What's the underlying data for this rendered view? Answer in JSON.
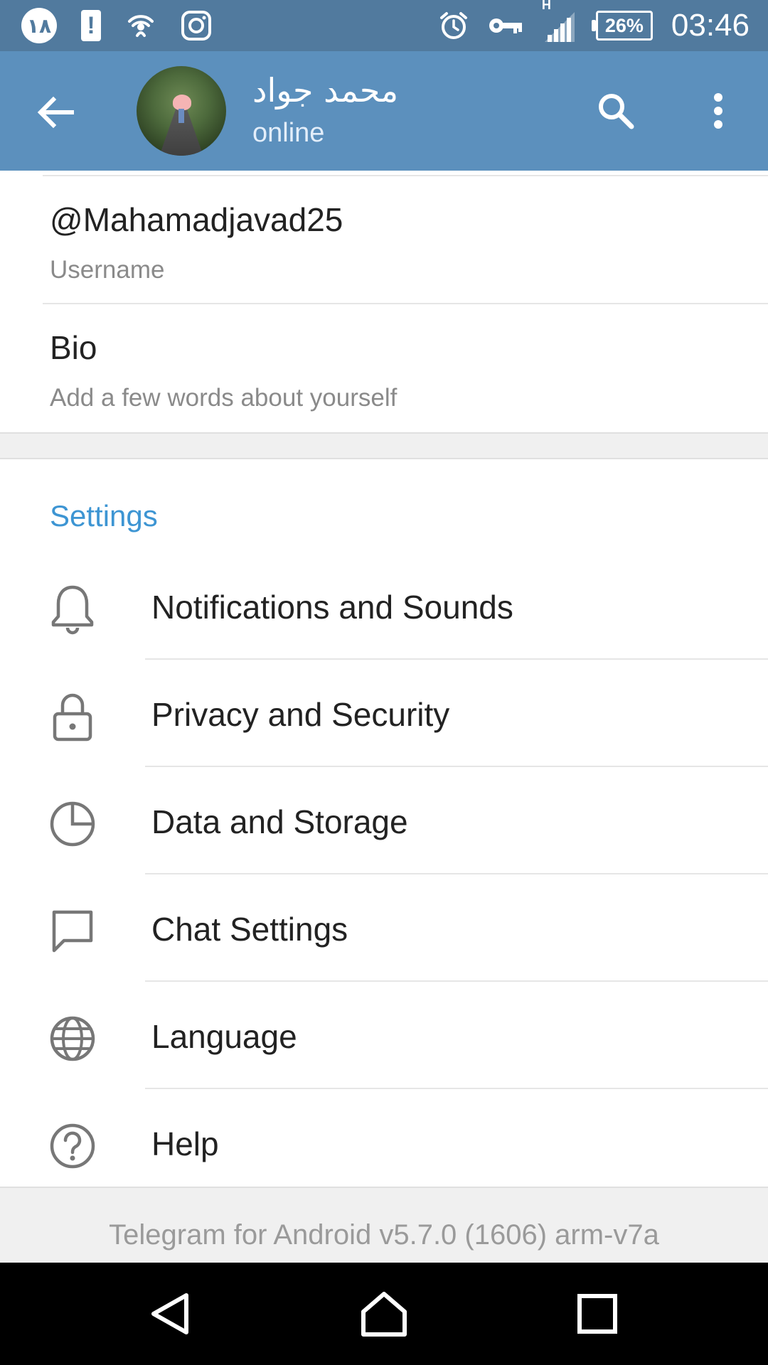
{
  "status_bar": {
    "badge_text": "۱۸",
    "notification_text": "!",
    "battery_percent": "26%",
    "network_type": "H",
    "time": "03:46"
  },
  "header": {
    "name": "محمد جواد",
    "status": "online"
  },
  "profile": {
    "username_value": "@Mahamadjavad25",
    "username_label": "Username",
    "bio_value": "Bio",
    "bio_label": "Add a few words about yourself"
  },
  "settings": {
    "title": "Settings",
    "items": [
      {
        "label": "Notifications and Sounds",
        "icon": "bell-icon"
      },
      {
        "label": "Privacy and Security",
        "icon": "lock-icon"
      },
      {
        "label": "Data and Storage",
        "icon": "pie-chart-icon"
      },
      {
        "label": "Chat Settings",
        "icon": "chat-bubble-icon"
      },
      {
        "label": "Language",
        "icon": "globe-icon"
      },
      {
        "label": "Help",
        "icon": "help-circle-icon"
      }
    ]
  },
  "footer": {
    "version_text": "Telegram for Android v5.7.0 (1606) arm-v7a"
  },
  "colors": {
    "status_bar": "#517a9e",
    "header": "#5c90bd",
    "accent": "#3d95d3"
  }
}
